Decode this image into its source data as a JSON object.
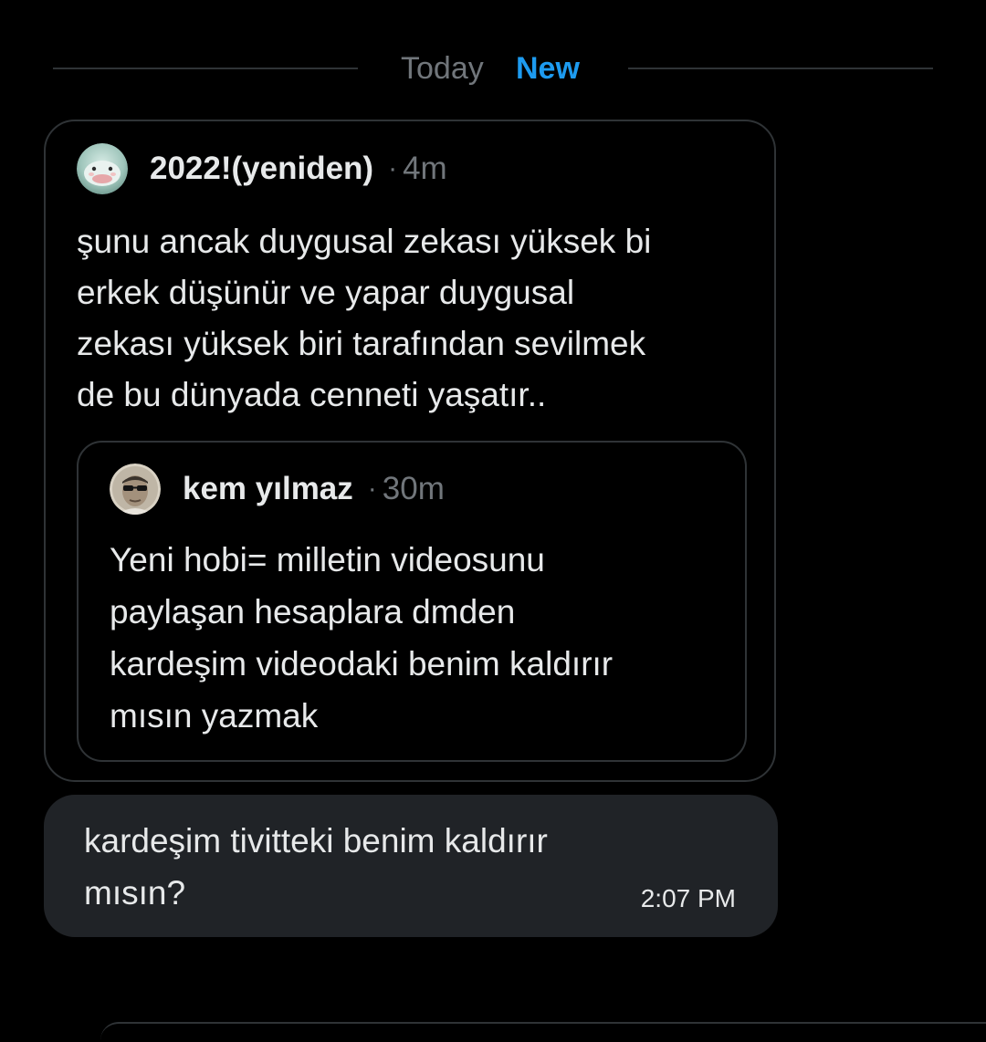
{
  "divider": {
    "today_label": "Today",
    "new_label": "New"
  },
  "shared_post": {
    "author": "2022!(yeniden)",
    "separator": "·",
    "time": "4m",
    "text": "şunu ancak duygusal zekası yüksek bi\nerkek düşünür ve yapar duygusal\nzekası yüksek biri tarafından sevilmek\nde bu dünyada cenneti yaşatır..",
    "avatar_icon": "dolphin-avatar-icon"
  },
  "quoted_post": {
    "author": "kem yılmaz",
    "separator": "·",
    "time": "30m",
    "text": "Yeni hobi= milletin videosunu\npaylaşan hesaplara dmden\nkardeşim videodaki benim kaldırır\nmısın yazmak",
    "avatar_icon": "sunglasses-person-avatar-icon"
  },
  "message": {
    "text": "kardeşim tivitteki benim kaldırır\nmısın?",
    "time": "2:07 PM"
  },
  "colors": {
    "background": "#000000",
    "accent": "#1d9bf0",
    "text_primary": "#e7e9ea",
    "text_secondary": "#71767b",
    "border": "#2f3336",
    "bubble": "#202327"
  }
}
